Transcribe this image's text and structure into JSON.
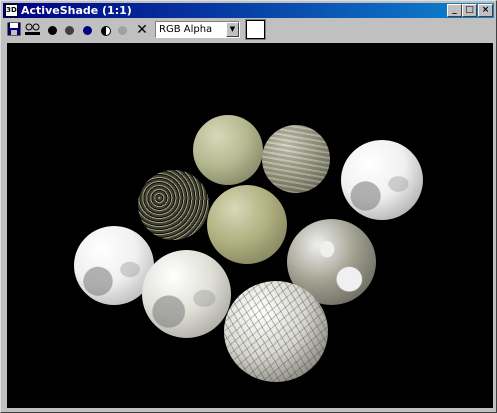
{
  "window": {
    "title": "ActiveShade (1:1)",
    "app_icon_label": "3D",
    "buttons": {
      "minimize": "_",
      "maximize": "□",
      "close": "×"
    }
  },
  "toolbar": {
    "save_icon": "floppy-disk-icon",
    "clone_icon": "clone-icon",
    "channel_select": {
      "value": "RGB Alpha"
    },
    "channel_colors": {
      "red": "#000000",
      "green": "#404040",
      "blue": "#000080",
      "mono": "#808080",
      "alpha": "#a0a0a0"
    },
    "clear_icon_glyph": "✕",
    "swatch_color": "#ffffff"
  },
  "viewport": {
    "background": "#000000"
  },
  "materials": [
    {
      "id": 1,
      "base": "#b4b890",
      "shade": "#6c7050",
      "highlight": "#d8d8b8",
      "style": "matte"
    },
    {
      "id": 2,
      "base": "#a0a088",
      "shade": "#606050",
      "highlight": "#d0d0c0",
      "style": "striped"
    },
    {
      "id": 3,
      "base": "#f0f0f0",
      "shade": "#909090",
      "highlight": "#ffffff",
      "style": "chrome"
    },
    {
      "id": 4,
      "base": "#404030",
      "shade": "#101010",
      "highlight": "#a0a080",
      "style": "noise"
    },
    {
      "id": 5,
      "base": "#b0b080",
      "shade": "#707050",
      "highlight": "#d8d8b8",
      "style": "matte"
    },
    {
      "id": 6,
      "base": "#a0a090",
      "shade": "#505048",
      "highlight": "#f0f0f0",
      "style": "spots"
    },
    {
      "id": 7,
      "base": "#f0f0f0",
      "shade": "#a0a0a0",
      "highlight": "#ffffff",
      "style": "chrome"
    },
    {
      "id": 8,
      "base": "#e0e0d8",
      "shade": "#909088",
      "highlight": "#ffffff",
      "style": "chrome"
    },
    {
      "id": 9,
      "base": "#d8d8d0",
      "shade": "#606058",
      "highlight": "#ffffff",
      "style": "crackle"
    }
  ]
}
